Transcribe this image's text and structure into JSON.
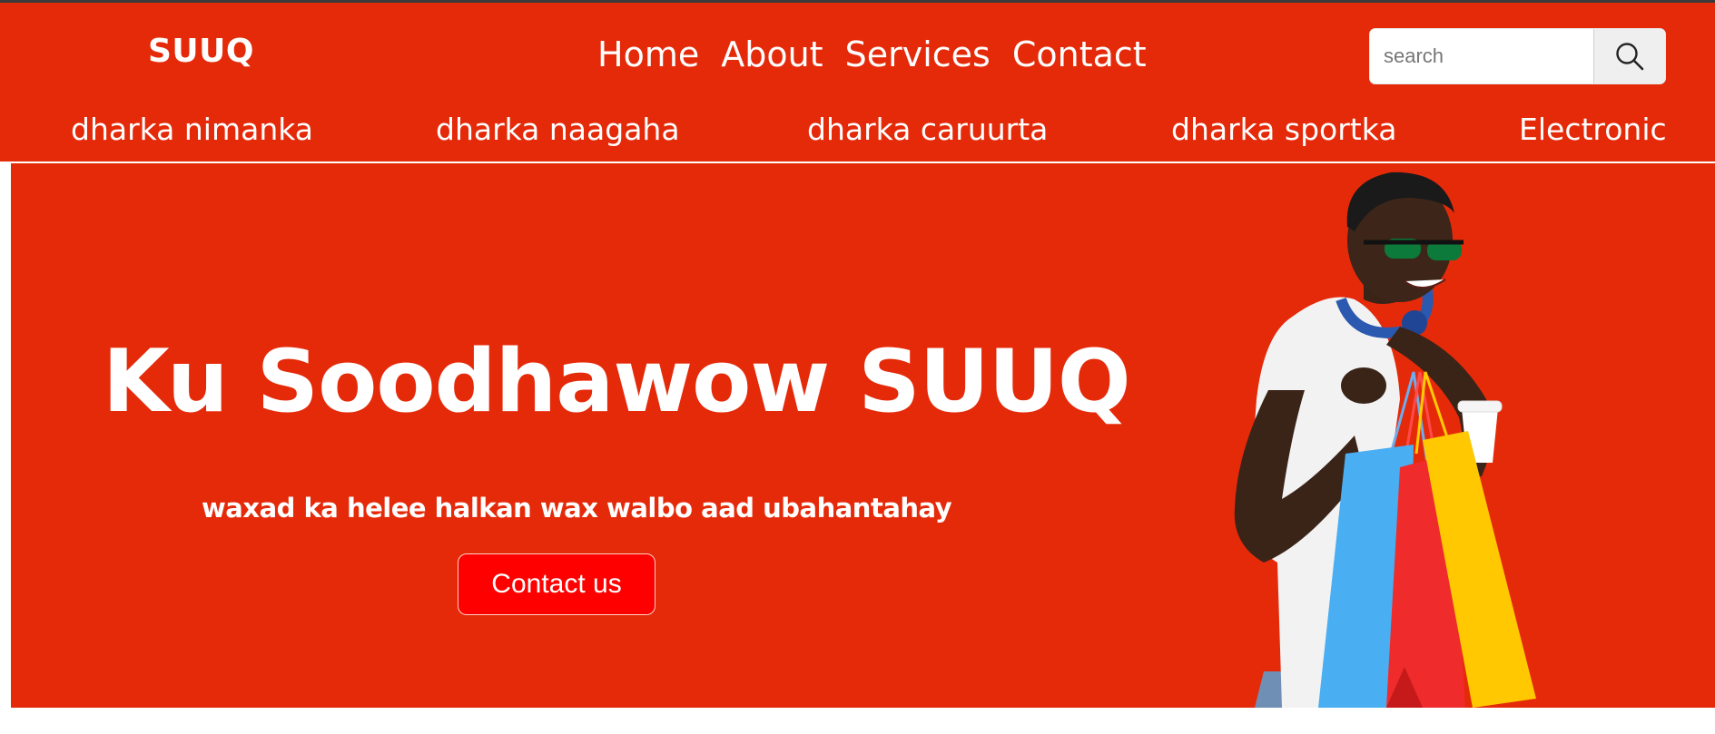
{
  "header": {
    "logo": "SUUQ",
    "nav": [
      "Home",
      "About",
      "Services",
      "Contact"
    ],
    "search": {
      "placeholder": "search",
      "value": ""
    },
    "categories": [
      "dharka nimanka",
      "dharka naagaha",
      "dharka caruurta",
      "dharka sportka",
      "Electronic"
    ]
  },
  "hero": {
    "title": "Ku Soodhawow SUUQ",
    "subtitle": "waxad ka helee halkan wax walbo aad ubahantahay",
    "cta_label": "Contact us"
  },
  "colors": {
    "brand_red": "#e52a0a",
    "button_red": "#ff0000",
    "text": "#ffffff"
  },
  "icons": {
    "search": "search-icon"
  }
}
